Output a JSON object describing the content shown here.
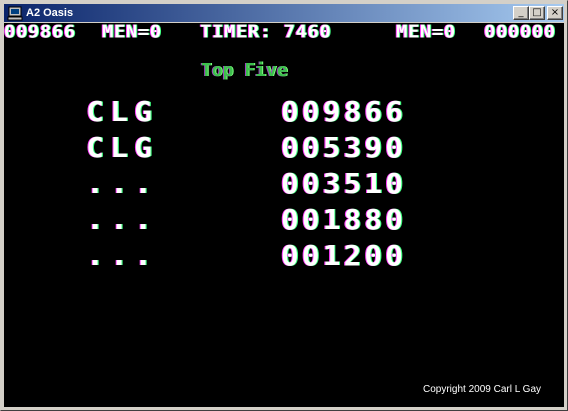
{
  "window": {
    "title": "A2 Oasis",
    "buttons": {
      "minimize": "_",
      "maximize": "□",
      "close": "×"
    }
  },
  "hud": {
    "score_player1": "009866",
    "men_player1": "MEN=0",
    "timer": "TIMER: 7460",
    "men_player2": "MEN=0",
    "score_player2": "000000"
  },
  "high_scores": {
    "heading": "Top Five",
    "entries": [
      {
        "initials": "CLG",
        "score": "009866"
      },
      {
        "initials": "CLG",
        "score": "005390"
      },
      {
        "initials": "...",
        "score": "003510"
      },
      {
        "initials": "...",
        "score": "001880"
      },
      {
        "initials": "...",
        "score": "001200"
      }
    ]
  },
  "copyright": "Copyright 2009 Carl L Gay",
  "colors": {
    "title_bar_start": "#0a246a",
    "title_bar_end": "#a6caf0",
    "screen_background": "#000000",
    "heading_green": "#3dbf4d",
    "text": "#ffffff"
  }
}
